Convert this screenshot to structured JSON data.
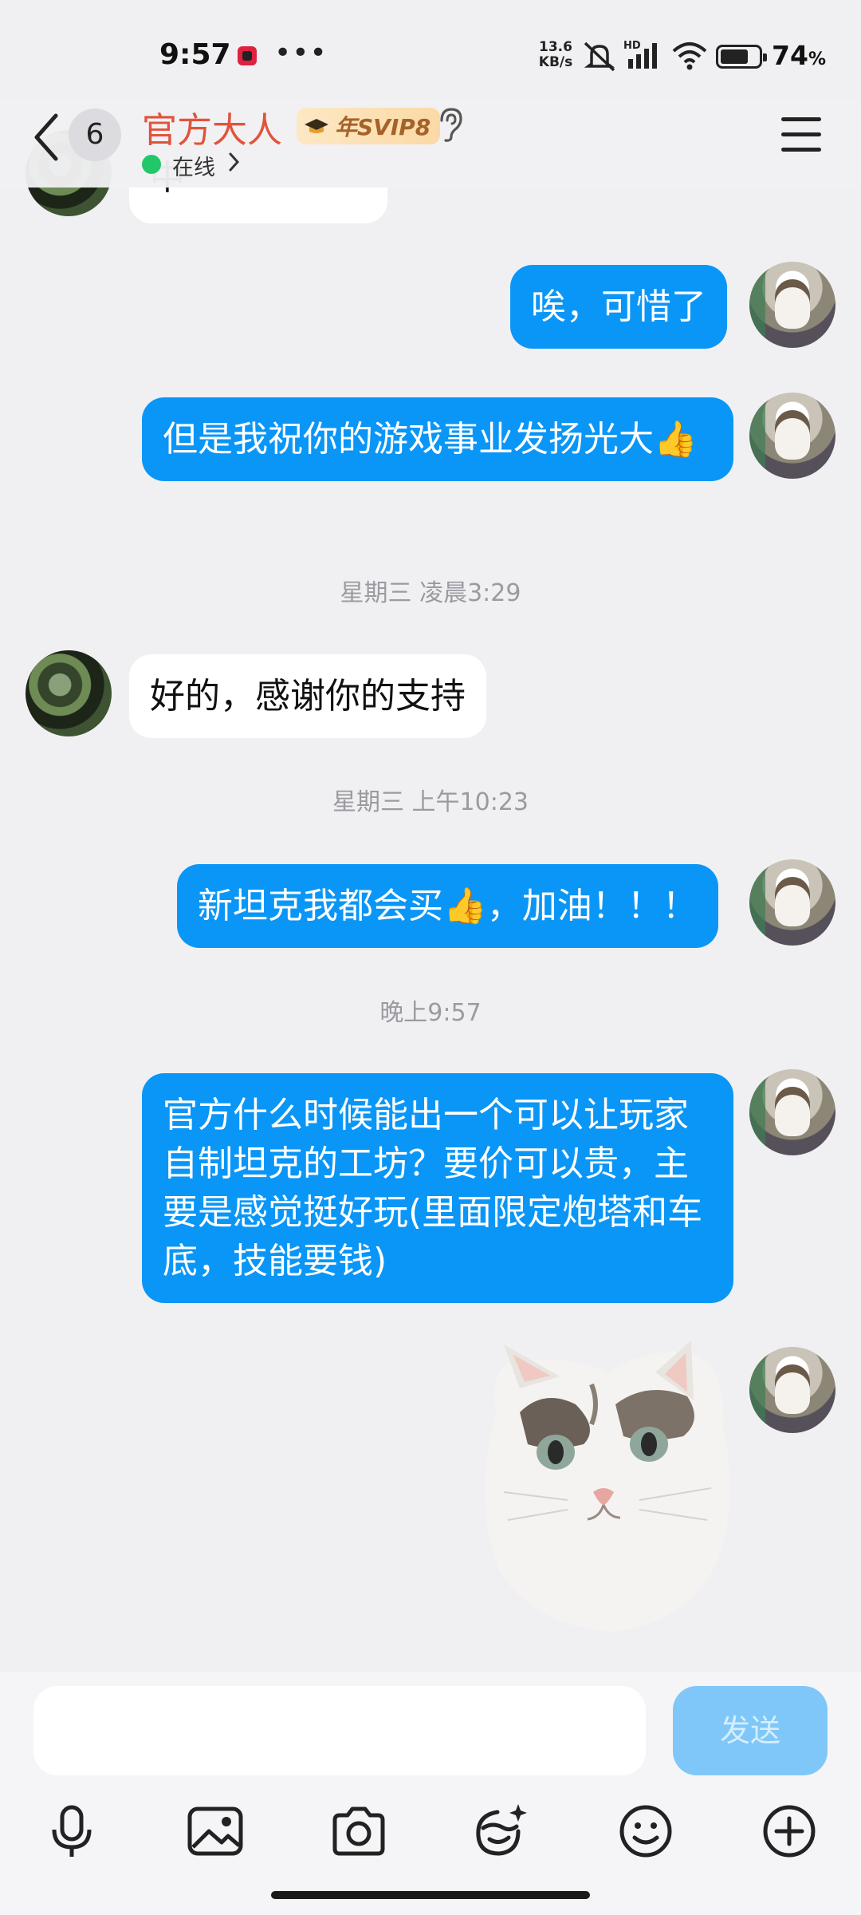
{
  "status_bar": {
    "time": "9:57",
    "dots": "•••",
    "net_speed_value": "13.6",
    "net_speed_unit": "KB/s",
    "network_tag": "HD",
    "battery_percent": "74",
    "battery_percent_sign": "%",
    "battery_level": 0.74
  },
  "header": {
    "unread_count": "6",
    "contact_name": "官方大人",
    "vip_label": "年SVIP8",
    "status_text": "在线",
    "name_color": "#e1533b",
    "online_color": "#22c76a"
  },
  "messages": [
    {
      "id": "peer-top",
      "side": "incoming",
      "text": "中"
    },
    {
      "id": "out-1",
      "side": "outgoing",
      "text": "唉，可惜了"
    },
    {
      "id": "out-2",
      "side": "outgoing",
      "text": "但是我祝你的游戏事业发扬光大👍"
    },
    {
      "id": "ts-1",
      "type": "timestamp",
      "text": "星期三 凌晨3:29"
    },
    {
      "id": "in-1",
      "side": "incoming",
      "text": "好的，感谢你的支持"
    },
    {
      "id": "ts-2",
      "type": "timestamp",
      "text": "星期三 上午10:23"
    },
    {
      "id": "out-3",
      "side": "outgoing",
      "text": "新坦克我都会买👍，加油！！！"
    },
    {
      "id": "ts-3",
      "type": "timestamp",
      "text": "晚上9:57"
    },
    {
      "id": "out-4",
      "side": "outgoing",
      "text": "官方什么时候能出一个可以让玩家自制坦克的工坊？要价可以贵，主要是感觉挺好玩(里面限定炮塔和车底，技能要钱)"
    },
    {
      "id": "out-5",
      "side": "outgoing",
      "type": "sticker",
      "sticker": "cat-sticker"
    }
  ],
  "composer": {
    "input_value": "",
    "send_label": "发送",
    "tools": [
      "microphone-icon",
      "image-icon",
      "camera-icon",
      "emoji-tool-icon",
      "smiley-icon",
      "plus-icon"
    ]
  },
  "colors": {
    "outgoing_bubble": "#0a96f7",
    "incoming_bubble": "#ffffff",
    "send_button": "#7fc7f8",
    "background": "#f0f0f3"
  }
}
